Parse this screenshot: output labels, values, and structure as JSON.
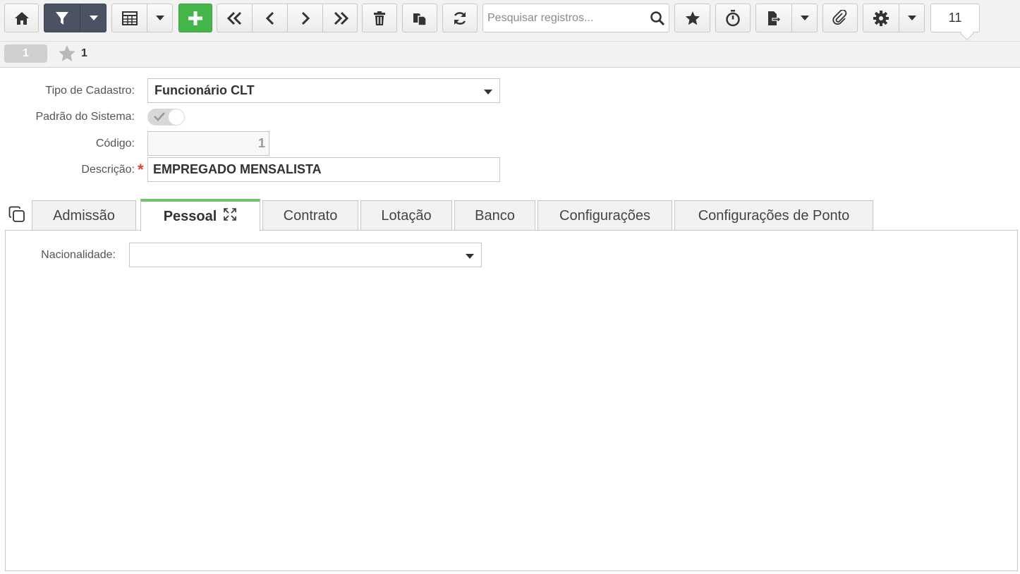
{
  "toolbar": {
    "search_placeholder": "Pesquisar registros...",
    "counter": "11",
    "icons": [
      "home-icon",
      "filter-icon",
      "chevron-down-icon",
      "grid-icon",
      "plus-icon",
      "first-icon",
      "prev-icon",
      "next-icon",
      "last-icon",
      "trash-icon",
      "copy-icon",
      "refresh-icon",
      "search-icon",
      "star-icon",
      "timer-icon",
      "export-icon",
      "paperclip-icon",
      "gear-icon"
    ]
  },
  "subbar": {
    "record": "1",
    "favorite_count": "1"
  },
  "form": {
    "tipo_label": "Tipo de Cadastro:",
    "tipo_value": "Funcionário CLT",
    "padrao_label": "Padrão do Sistema:",
    "codigo_label": "Código:",
    "codigo_value": "1",
    "descricao_label": "Descrição:",
    "descricao_value": "EMPREGADO MENSALISTA",
    "required_mark": "*"
  },
  "tabs": [
    {
      "label": "Admissão"
    },
    {
      "label": "Pessoal"
    },
    {
      "label": "Contrato"
    },
    {
      "label": "Lotação"
    },
    {
      "label": "Banco"
    },
    {
      "label": "Configurações"
    },
    {
      "label": "Configurações de Ponto"
    }
  ],
  "active_tab": "Pessoal",
  "panel": {
    "nacionalidade_label": "Nacionalidade:",
    "nacionalidade_value": ""
  },
  "colors": {
    "accent_green": "#44b549",
    "active_tab_border": "#6cc26f",
    "dark_button": "#4b5363",
    "required": "#e0412f"
  }
}
